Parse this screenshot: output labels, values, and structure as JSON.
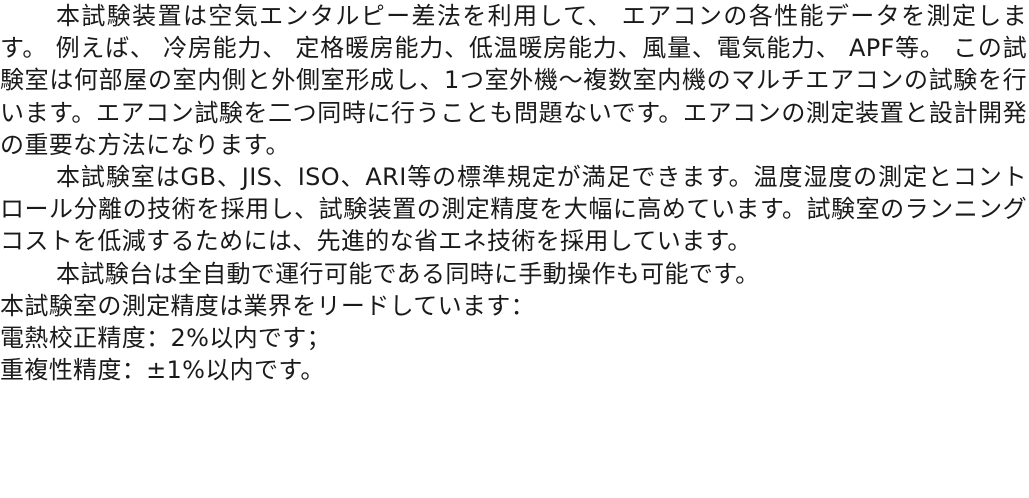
{
  "content": {
    "para1": "本試験装置は空気エンタルピー差法を利用して、 エアコンの各性能データを測定します。 例えば、 冷房能力、 定格暖房能力、低温暖房能力、風量、電気能力、 APF等。 この試験室は何部屋の室内側と外側室形成し、1つ室外機～複数室内機のマルチエアコンの試験を行います。エアコン試験を二つ同時に行うことも問題ないです。エアコンの測定装置と設計開発の重要な方法になります。",
    "para2": "本試験室はGB、JIS、ISO、ARI等の標準規定が満足できます。温度湿度の測定とコントロール分離の技術を採用し、試験装置の測定精度を大幅に高めています。試験室のランニングコストを低減するためには、先進的な省エネ技術を採用しています。",
    "para3": "本試験台は全自動で運行可能である同時に手動操作も可能です。",
    "para4": "本試験室の測定精度は業界をリードしています：",
    "line_heat": "電熱校正精度：2%以内です；",
    "line_repeat": "重複性精度：±1%以内です。"
  }
}
